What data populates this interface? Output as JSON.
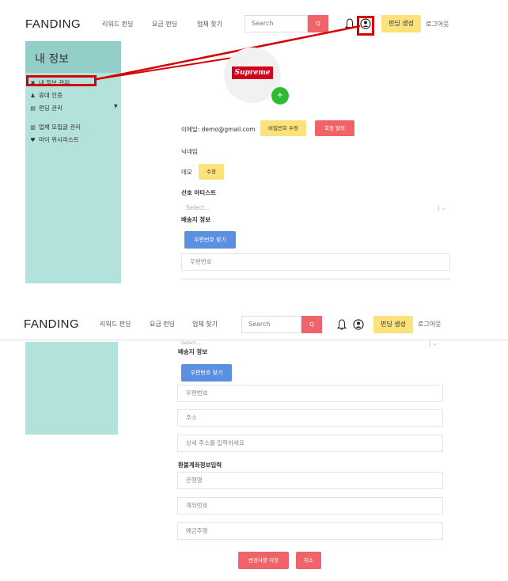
{
  "nav": {
    "logo": "FANDING",
    "links": [
      "리워드 펀딩",
      "요금 펀딩",
      "업체 찾기"
    ],
    "search_placeholder": "Search",
    "search_btn": "Q",
    "create_label": "펀딩 생성",
    "logout_label": "로그아웃"
  },
  "sidebar": {
    "title": "내 정보",
    "items": [
      {
        "label": "내 정보 관리",
        "icon": "wrench-icon"
      },
      {
        "label": "휴대 인증",
        "icon": "person-icon"
      },
      {
        "label": "펀딩 관리",
        "icon": "file-icon"
      },
      {
        "label": "업체 모집글 관리",
        "icon": "chart-icon"
      },
      {
        "label": "마이 위시리스트",
        "icon": "heart-icon"
      }
    ]
  },
  "profile": {
    "brand": "Supreme",
    "plus": "+",
    "email": "이메일: demo@gmail.com",
    "change_password": "비밀번호 수정",
    "withdraw": "회원 탈퇴",
    "nickname_label": "닉네임",
    "nickname_value": "데모",
    "edit_label": "수정",
    "artist_label": "선호 아티스트",
    "select_placeholder": "Select...",
    "select_partial": "Select..."
  },
  "shipping": {
    "title": "배송지 정보",
    "find_zip": "우편번호 찾기",
    "zip_placeholder": "우편번호",
    "addr_placeholder": "주소",
    "detail_placeholder": "상세 주소를 입력하세요"
  },
  "refund": {
    "title": "환불계좌정보입력",
    "bank_placeholder": "은행명",
    "account_placeholder": "계좌번호",
    "holder_placeholder": "예금주명"
  },
  "actions": {
    "save": "변경사항 저장",
    "cancel": "취소"
  },
  "colors": {
    "accent_red": "#f0636a",
    "accent_yellow": "#fbe27a",
    "accent_blue": "#5b8fe0",
    "sidebar": "#b3e2dd",
    "highlight": "#d50000"
  }
}
